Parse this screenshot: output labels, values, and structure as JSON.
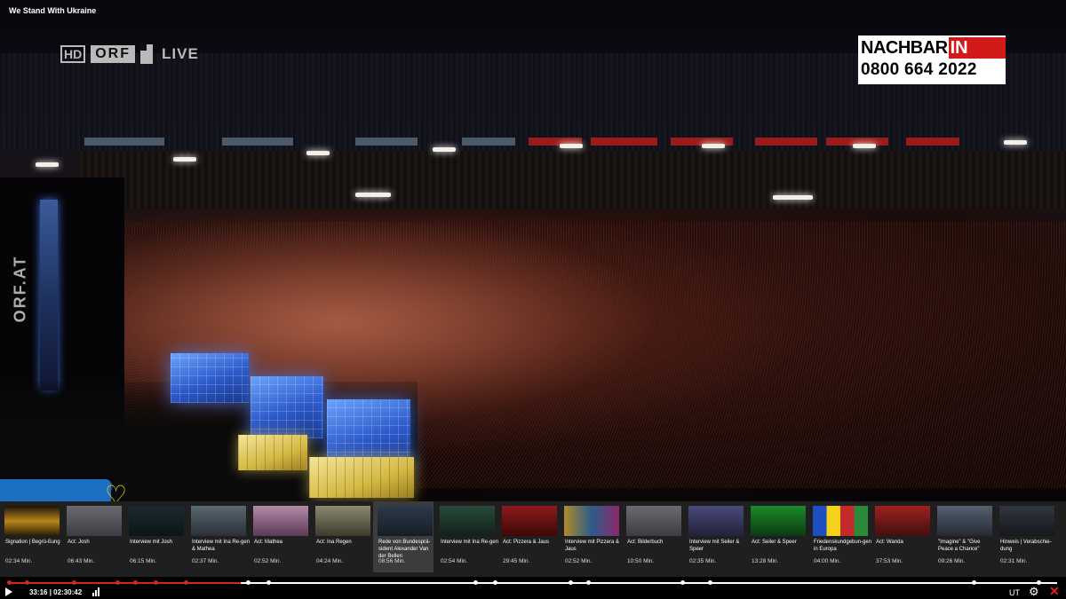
{
  "window": {
    "title": "We Stand With Ukraine"
  },
  "broadcast": {
    "hd_badge": "HD",
    "channel": "ORF",
    "live_label": "LIVE",
    "side_watermark": "ORF.AT",
    "donation": {
      "label_black": "NACHBAR",
      "label_red": "IN NOT",
      "phone": "0800 664 2022"
    }
  },
  "chapters": [
    {
      "title": "Signation | Begrü-ßung",
      "duration": "02:34 Min.",
      "thumb": "stage-gold",
      "active": false
    },
    {
      "title": "Act: Josh",
      "duration": "06:43 Min.",
      "thumb": "performer-grey",
      "active": false
    },
    {
      "title": "Interview mit Josh",
      "duration": "06:15 Min.",
      "thumb": "interview-dark",
      "active": false
    },
    {
      "title": "Interview mit Ina Re-gen & Mathea",
      "duration": "02:37 Min.",
      "thumb": "interview-three",
      "active": false
    },
    {
      "title": "Act: Mathea",
      "duration": "02:52 Min.",
      "thumb": "performer-pink",
      "active": false
    },
    {
      "title": "Act: Ina Regen",
      "duration": "04:24 Min.",
      "thumb": "performer-stage",
      "active": false
    },
    {
      "title": "Rede von Bundesprä-sident Alexander Van der Bellen",
      "duration": "08:56 Min.",
      "thumb": "speech",
      "active": true
    },
    {
      "title": "Interview mit Ina Re-gen",
      "duration": "02:54 Min.",
      "thumb": "interview-green",
      "active": false
    },
    {
      "title": "Act: Pizzera & Jaus",
      "duration": "29:45 Min.",
      "thumb": "stage-red",
      "active": false
    },
    {
      "title": "Interview mit Pizzera & Jaus",
      "duration": "02:52 Min.",
      "thumb": "interview-colorful",
      "active": false
    },
    {
      "title": "Act: Bilderbuch",
      "duration": "10:50 Min.",
      "thumb": "performer-grey",
      "active": false
    },
    {
      "title": "Interview mit Seiler & Speer",
      "duration": "02:35 Min.",
      "thumb": "interview-purple",
      "active": false
    },
    {
      "title": "Act: Seiler & Speer",
      "duration": "13:28 Min.",
      "thumb": "stage-green",
      "active": false
    },
    {
      "title": "Friedenskundgebun-gen in Europa",
      "duration": "04:00 Min.",
      "thumb": "flags",
      "active": false
    },
    {
      "title": "Act: Wanda",
      "duration": "37:53 Min.",
      "thumb": "stage-red2",
      "active": false
    },
    {
      "title": "\"Imagine\" & \"Give Peace a Chance\"",
      "duration": "09:26 Min.",
      "thumb": "group",
      "active": false
    },
    {
      "title": "Hinweis | Verabschie-dung",
      "duration": "02:31 Min.",
      "thumb": "host",
      "active": false
    }
  ],
  "player": {
    "current_time": "33:16",
    "total_time": "02:30:42",
    "progress_fraction": 0.2208,
    "subtitles_label": "UT",
    "accent_color": "#d0261c",
    "icons": {
      "play": "play-icon",
      "volume": "volume-icon",
      "settings": "gear-icon",
      "close": "close-icon"
    }
  },
  "colors": {
    "ukraine_blue": "#1d6fc3",
    "ukraine_yellow": "#f5d21a",
    "donation_red": "#d31a1a"
  }
}
